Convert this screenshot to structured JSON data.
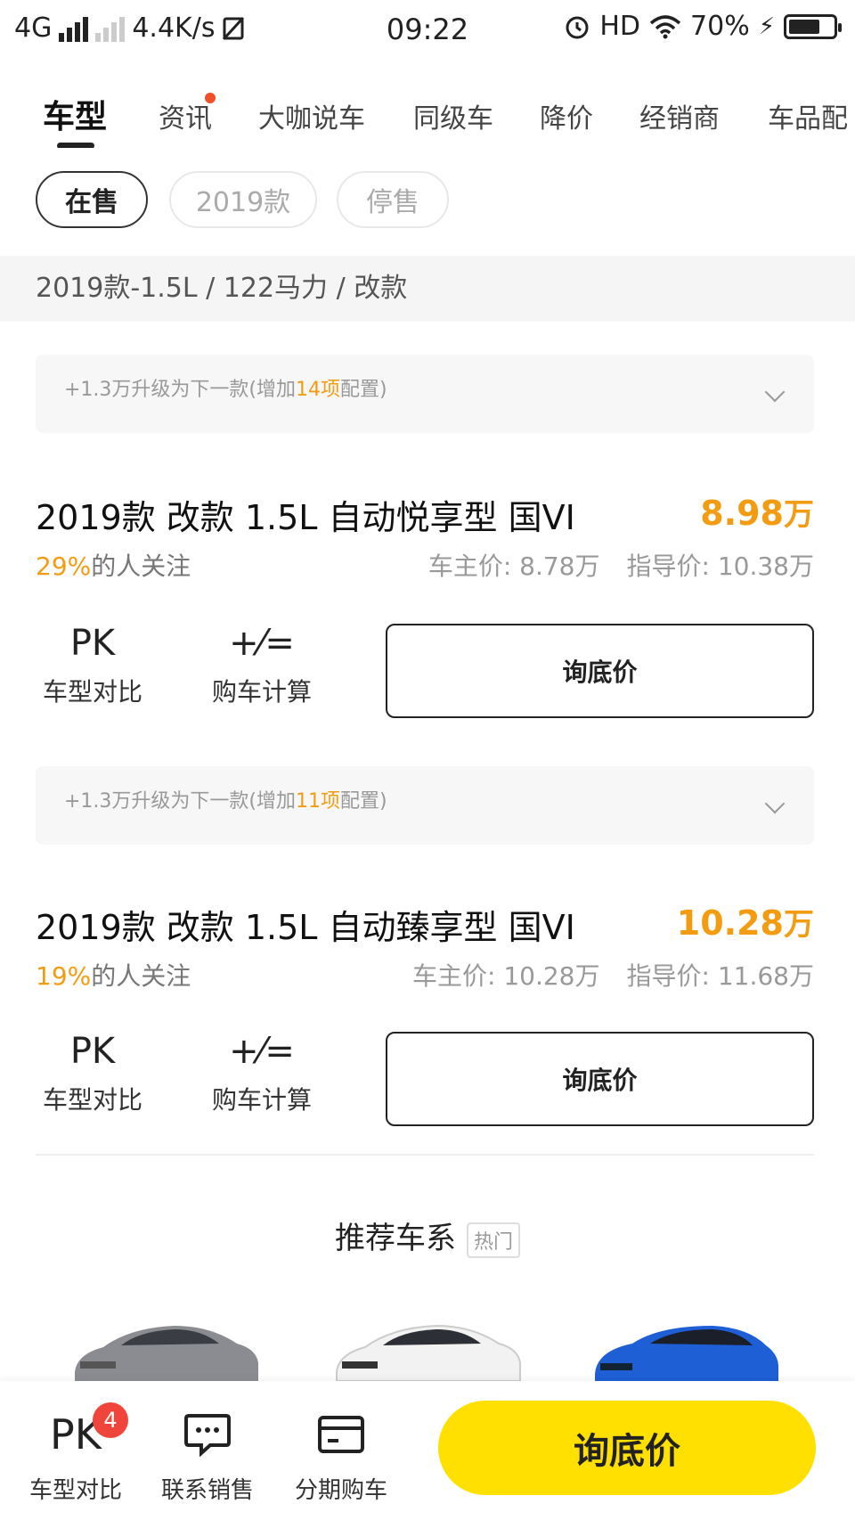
{
  "status_bar": {
    "network": "4G",
    "speed": "4.4K/s",
    "time": "09:22",
    "hd": "HD",
    "battery": "70%",
    "battery_level": 0.7
  },
  "tabs": [
    {
      "label": "车型",
      "active": true
    },
    {
      "label": "资讯",
      "dot": true
    },
    {
      "label": "大咖说车"
    },
    {
      "label": "同级车"
    },
    {
      "label": "降价"
    },
    {
      "label": "经销商"
    },
    {
      "label": "车品配"
    }
  ],
  "filters": [
    {
      "label": "在售",
      "active": true
    },
    {
      "label": "2019款"
    },
    {
      "label": "停售"
    }
  ],
  "section_header": "2019款-1.5L / 122马力 / 改款",
  "cars": [
    {
      "upgrade_prefix": "+1.3万升级为下一款(增加",
      "upgrade_count": "14项",
      "upgrade_suffix": "配置)",
      "name": "2019款 改款 1.5L 自动悦享型 国VI",
      "price_num": "8.98",
      "price_unit": "万",
      "attention_pct": "29%",
      "attention_text": "的人关注",
      "owner_price": "车主价: 8.78万",
      "guide_price": "指导价: 10.38万",
      "compare_label": "车型对比",
      "calc_label": "购车计算",
      "ask_label": "询底价"
    },
    {
      "upgrade_prefix": "+1.3万升级为下一款(增加",
      "upgrade_count": "11项",
      "upgrade_suffix": "配置)",
      "name": "2019款 改款 1.5L 自动臻享型 国VI",
      "price_num": "10.28",
      "price_unit": "万",
      "attention_pct": "19%",
      "attention_text": "的人关注",
      "owner_price": "车主价: 10.28万",
      "guide_price": "指导价: 11.68万",
      "compare_label": "车型对比",
      "calc_label": "购车计算",
      "ask_label": "询底价"
    }
  ],
  "pk_icon_text": "PK",
  "calc_icon_text": "+⁄=",
  "recommend": {
    "title": "推荐车系",
    "badge": "热门"
  },
  "bottom_bar": {
    "compare_label": "车型对比",
    "compare_count": "4",
    "contact_label": "联系销售",
    "installment_label": "分期购车",
    "ask_label": "询底价"
  },
  "colors": {
    "accent": "#f39c12",
    "cta_yellow": "#ffe000",
    "badge_red": "#f0453a"
  }
}
